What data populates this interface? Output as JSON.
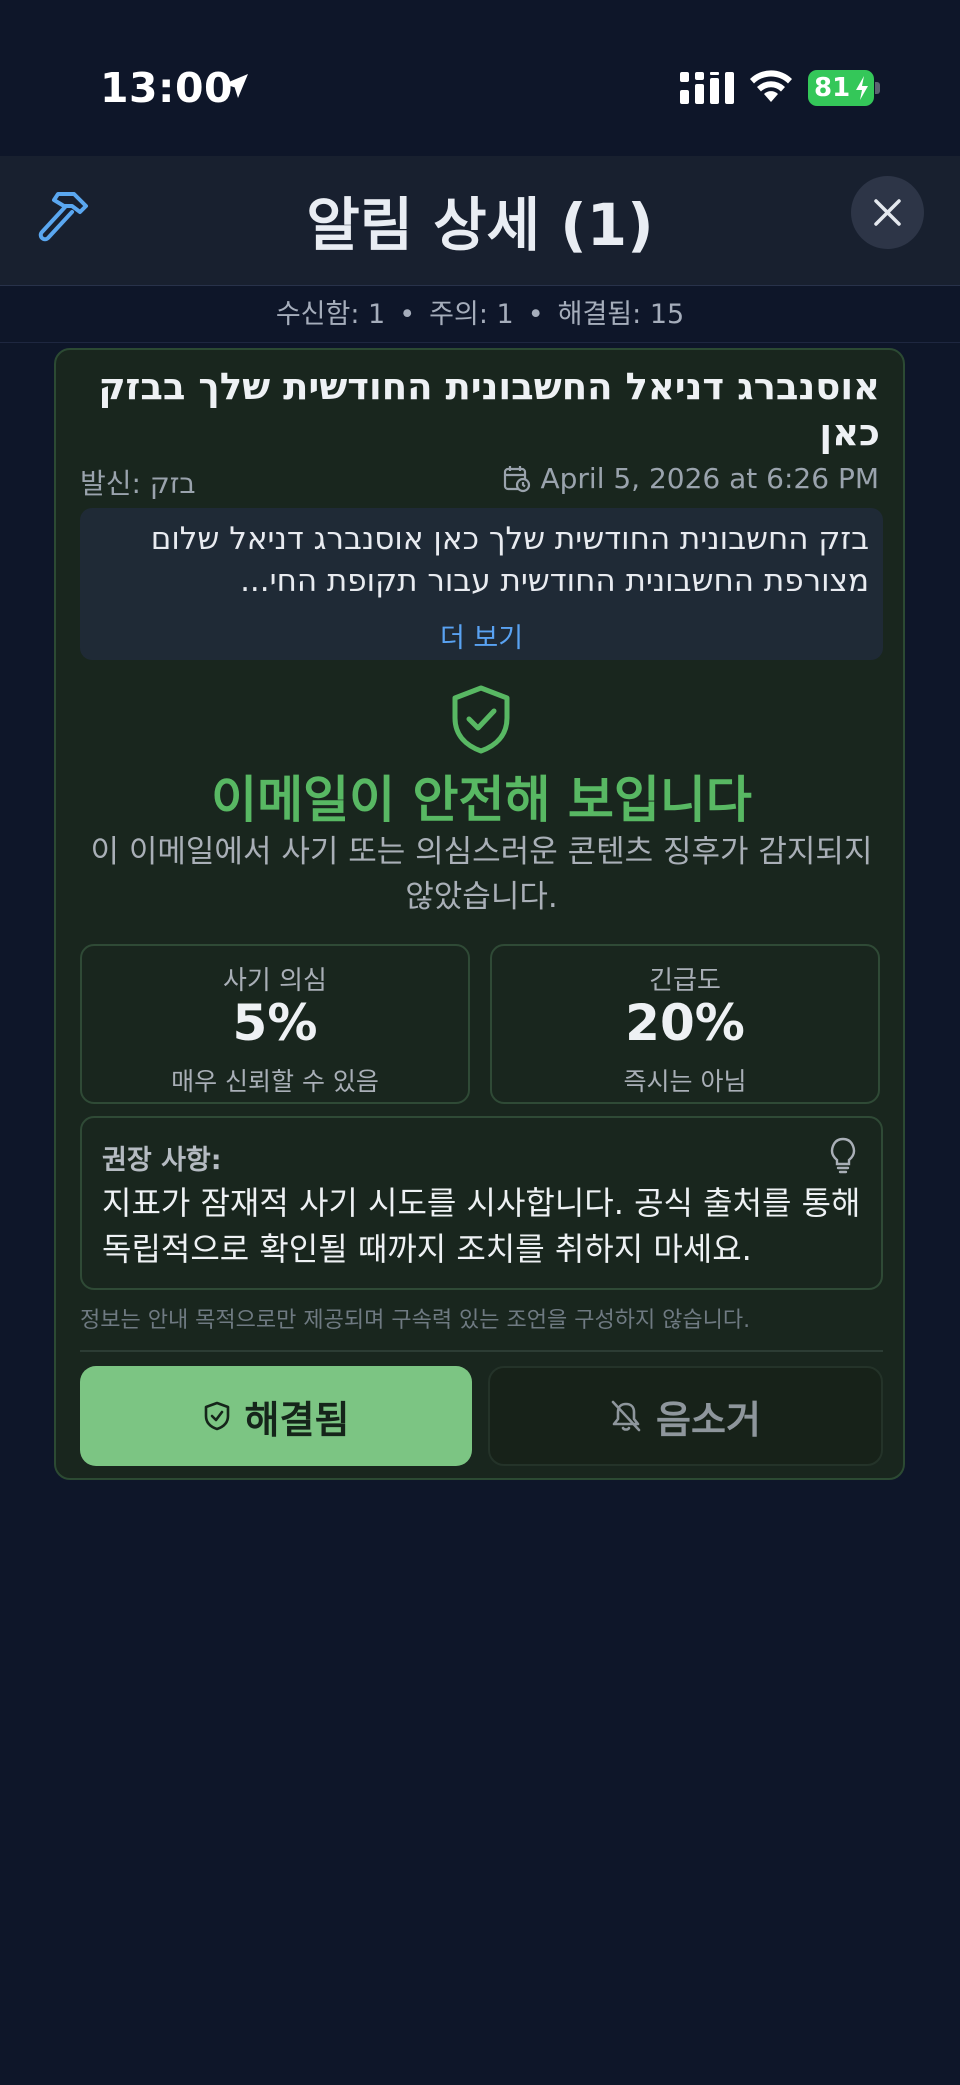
{
  "status_bar": {
    "time": "13:00",
    "battery": "81",
    "icons": [
      "location-arrow-icon",
      "cellular-signal-icon",
      "wifi-icon",
      "battery-charging-icon"
    ]
  },
  "header": {
    "title": "알림 상세 (1)",
    "left_icon": "hammer-icon",
    "right_icon": "close-icon"
  },
  "stats": {
    "received": "수신함: 1",
    "warning": "주의: 1",
    "resolved": "해결됨: 15",
    "separator": "•"
  },
  "alert": {
    "subject": "אוסנברג דניאל החשבונית החודשית שלך בבזק כאן",
    "sender": "발신: בזק",
    "date": "April 5, 2026 at 6:26 PM",
    "preview": "בזק החשבונית החודשית שלך כאן אוסנברג דניאל שלום מצורפת החשבונית החודשית עבור תקופת החי...",
    "more_link": "더 보기",
    "verdict_title": "이메일이 안전해 보입니다",
    "verdict_desc": "이 이메일에서 사기 또는 의심스러운 콘텐츠 징후가 감지되지 않았습니다.",
    "metrics": [
      {
        "label": "사기 의심",
        "value": "5%",
        "sub": "매우 신뢰할 수 있음"
      },
      {
        "label": "긴급도",
        "value": "20%",
        "sub": "즉시는 아님"
      }
    ],
    "recommendation_label": "권장 사항:",
    "recommendation_text": "지표가 잠재적 사기 시도를 시사합니다. 공식 출처를 통해 독립적으로 확인될 때까지 조치를 취하지 마세요.",
    "disclaimer": "정보는 안내 목적으로만 제공되며 구속력 있는 조언을 구성하지 않습니다.",
    "resolved_button": "해결됨",
    "mute_button": "음소거"
  },
  "colors": {
    "background": "#0e1629",
    "card": "#19261e",
    "safe_green": "#58b863",
    "button_green": "#7cc583",
    "link_blue": "#59a2f2"
  }
}
